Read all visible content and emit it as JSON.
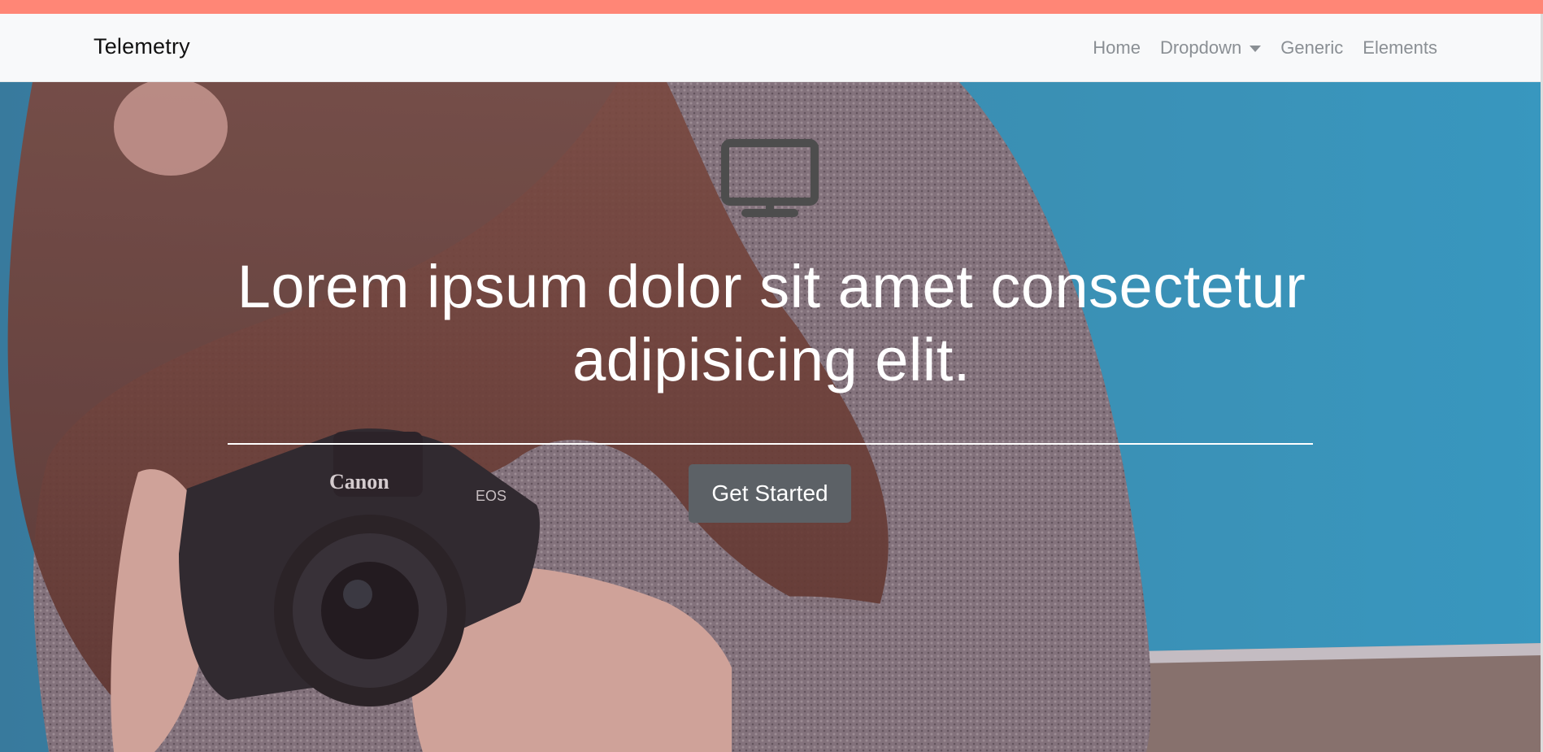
{
  "brand": "Telemetry",
  "nav": {
    "items": [
      {
        "label": "Home"
      },
      {
        "label": "Dropdown",
        "has_caret": true
      },
      {
        "label": "Generic"
      },
      {
        "label": "Elements"
      }
    ]
  },
  "hero": {
    "icon": "monitor-icon",
    "headline": "Lorem ipsum dolor sit amet consectetur adipisicing elit.",
    "cta_label": "Get Started",
    "background": "woman holding a Canon camera against blue sky",
    "camera_brand": "Canon",
    "camera_model": "EOS"
  },
  "colors": {
    "accent_bar": "#ff8676",
    "navbar_bg": "#f8f9fa",
    "nav_link": "#8a8f94",
    "cta_bg": "#5c6166",
    "sky": "#2fa4cc"
  }
}
